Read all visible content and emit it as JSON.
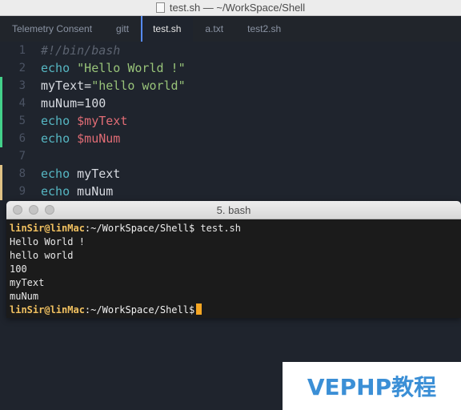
{
  "window": {
    "title": "test.sh — ~/WorkSpace/Shell"
  },
  "tabs": [
    {
      "label": "Telemetry Consent",
      "active": false
    },
    {
      "label": "gitt",
      "active": false
    },
    {
      "label": "test.sh",
      "active": true
    },
    {
      "label": "a.txt",
      "active": false
    },
    {
      "label": "test2.sh",
      "active": false
    }
  ],
  "editor": {
    "lines": [
      {
        "num": "1",
        "parts": [
          "#!/bin/bash"
        ]
      },
      {
        "num": "2",
        "parts": [
          "echo",
          " ",
          "\"Hello World !\""
        ]
      },
      {
        "num": "3",
        "parts": [
          "myText=",
          "\"hello world\""
        ]
      },
      {
        "num": "4",
        "parts": [
          "muNum=100"
        ]
      },
      {
        "num": "5",
        "parts": [
          "echo",
          " ",
          "$myText"
        ]
      },
      {
        "num": "6",
        "parts": [
          "echo",
          " ",
          "$muNum"
        ]
      },
      {
        "num": "7",
        "parts": []
      },
      {
        "num": "8",
        "parts": [
          "echo",
          " myText"
        ]
      },
      {
        "num": "9",
        "parts": [
          "echo",
          " muNum"
        ]
      }
    ],
    "colors": {
      "keyword": "#56b6c2",
      "string": "#98c379",
      "variable": "#e06c75",
      "added_marker": "#43d08a",
      "modified_marker": "#e0c285"
    }
  },
  "terminal": {
    "title": "5. bash",
    "prompt_user": "linSir@linMac",
    "prompt_path": ":~/WorkSpace/Shell$",
    "command": " test.sh",
    "output": [
      "Hello World !",
      "hello world",
      "100",
      "myText",
      "muNum"
    ]
  },
  "watermark": {
    "text": "VEPHP教程"
  }
}
